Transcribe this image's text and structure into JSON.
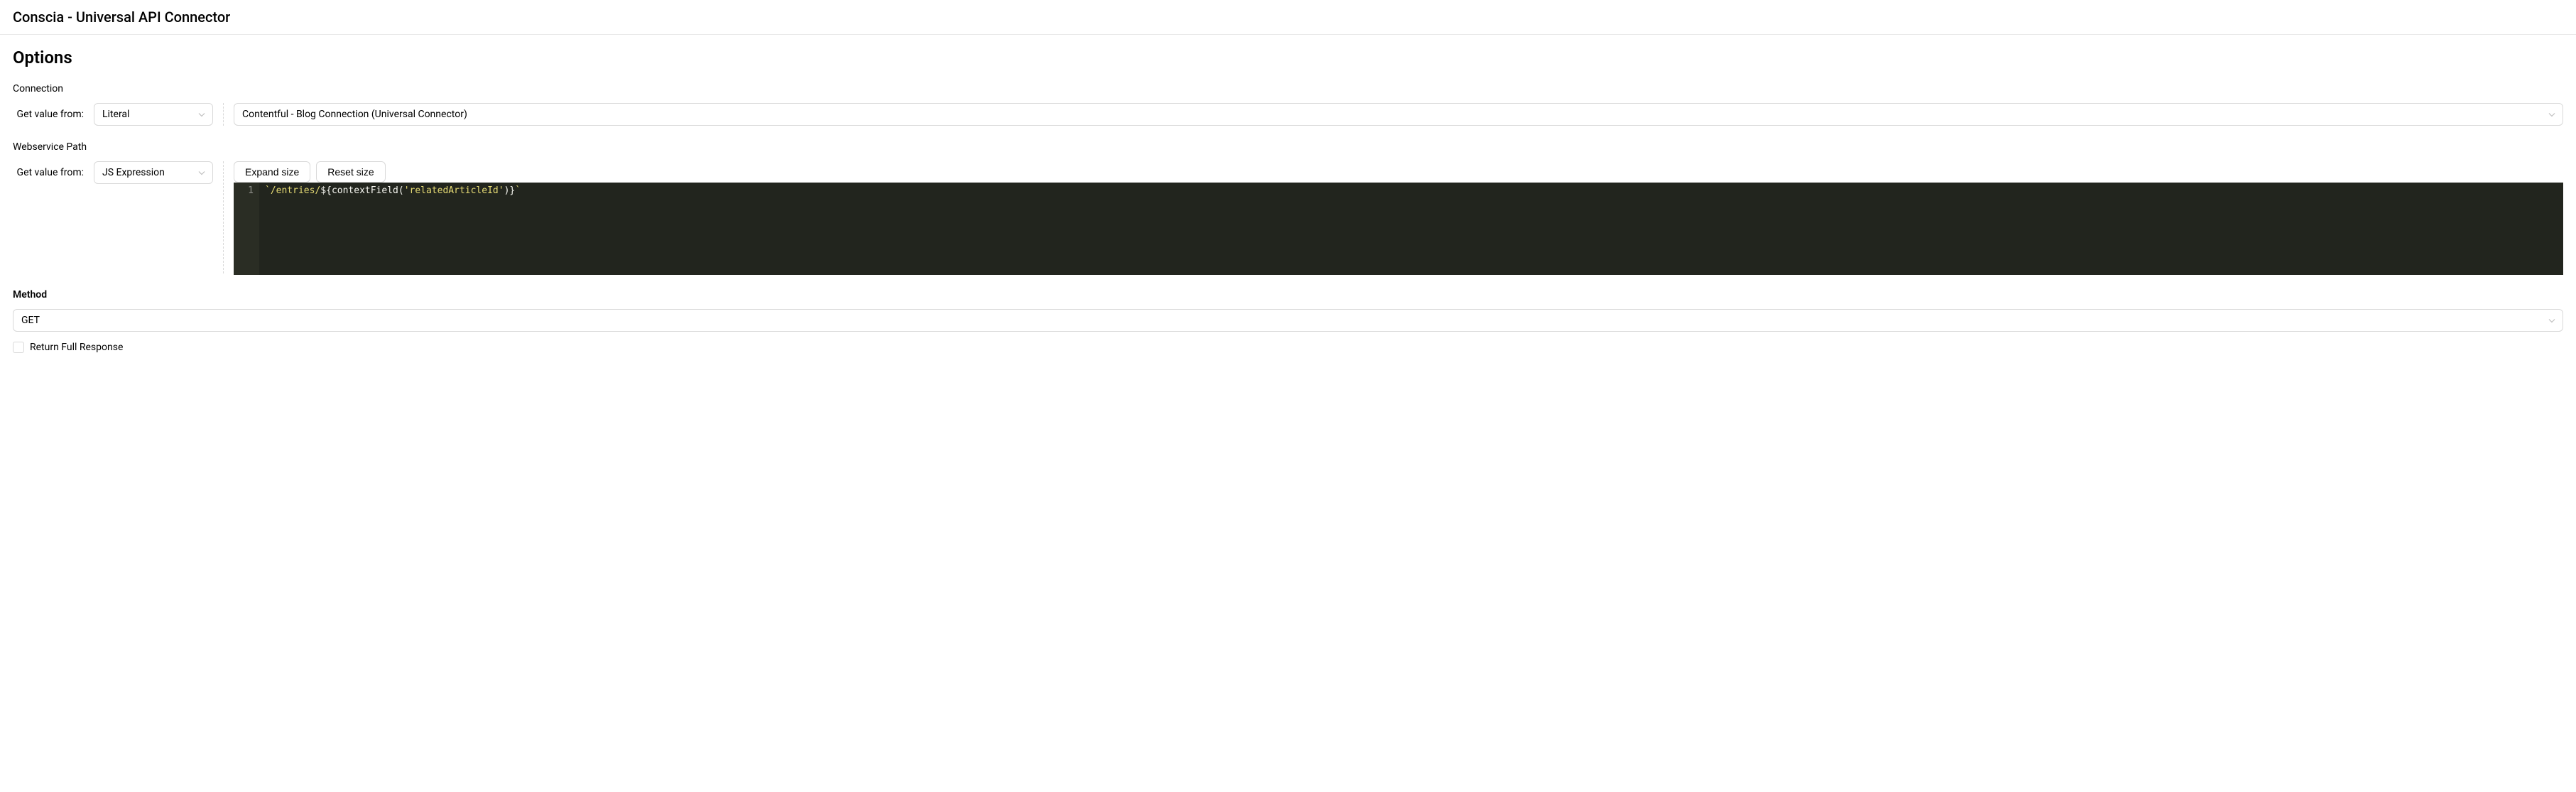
{
  "header": {
    "title": "Conscia - Universal API Connector"
  },
  "options": {
    "title": "Options",
    "connection": {
      "label": "Connection",
      "getValueFromLabel": "Get value from:",
      "selectorValue": "Literal",
      "value": "Contentful - Blog Connection (Universal Connector)"
    },
    "webservicePath": {
      "label": "Webservice Path",
      "getValueFromLabel": "Get value from:",
      "selectorValue": "JS Expression",
      "expandButton": "Expand size",
      "resetButton": "Reset size",
      "code": {
        "lineNumber": "1",
        "tokens": {
          "t1": "`/entries/",
          "t2": "${",
          "t3": "contextField",
          "t4": "(",
          "t5": "'relatedArticleId'",
          "t6": ")",
          "t7": "}",
          "t8": "`"
        }
      }
    },
    "method": {
      "label": "Method",
      "value": "GET"
    },
    "returnFullResponse": {
      "label": "Return Full Response",
      "checked": false
    }
  }
}
